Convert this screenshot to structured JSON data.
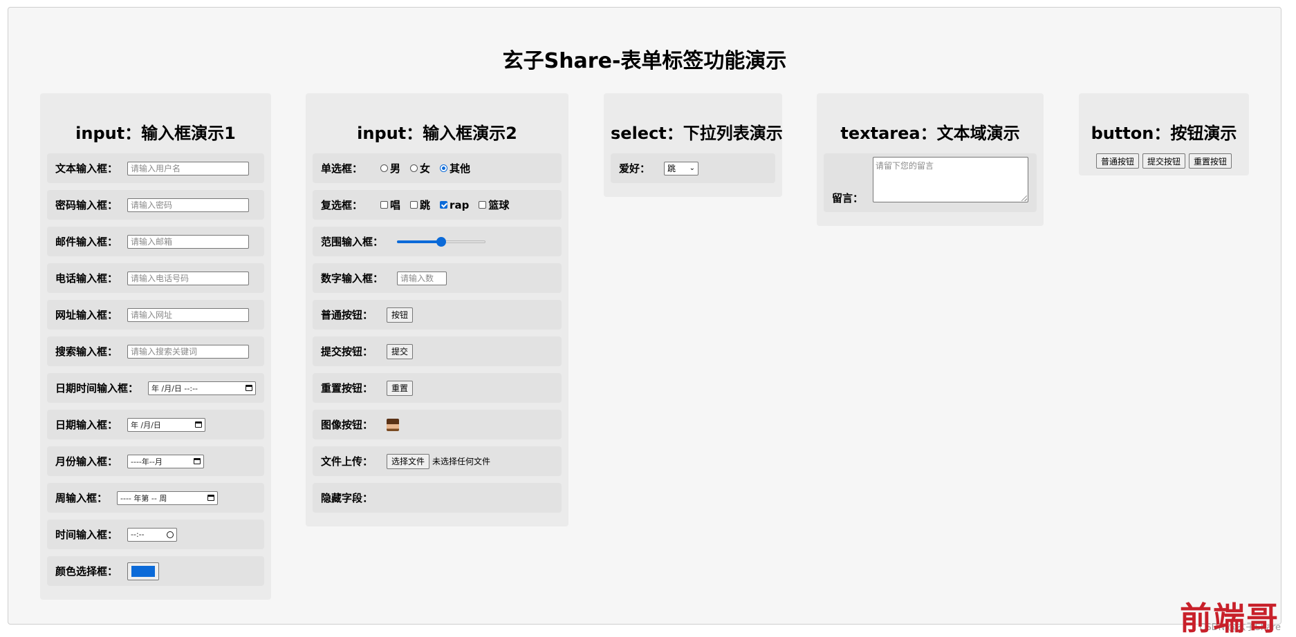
{
  "page_title": "玄子Share-表单标签功能演示",
  "col1": {
    "title": "input：输入框演示1",
    "text_label": "文本输入框：",
    "text_placeholder": "请输入用户名",
    "password_label": "密码输入框：",
    "password_placeholder": "请输入密码",
    "email_label": "邮件输入框：",
    "email_placeholder": "请输入邮箱",
    "tel_label": "电话输入框：",
    "tel_placeholder": "请输入电话号码",
    "url_label": "网址输入框：",
    "url_placeholder": "请输入网址",
    "search_label": "搜索输入框：",
    "search_placeholder": "请输入搜索关键词",
    "datetime_label": "日期时间输入框：",
    "datetime_value": "年 /月/日 --:--",
    "date_label": "日期输入框：",
    "date_value": "年 /月/日",
    "month_label": "月份输入框：",
    "month_value": "----年--月",
    "week_label": "周输入框：",
    "week_value": "---- 年第 -- 周",
    "time_label": "时间输入框：",
    "time_value": "--:--",
    "color_label": "颜色选择框：",
    "color_value": "#0b6ad8"
  },
  "col2": {
    "title": "input：输入框演示2",
    "radio_label": "单选框：",
    "radio_options": [
      "男",
      "女",
      "其他"
    ],
    "radio_selected": "其他",
    "checkbox_label": "复选框：",
    "checkbox_options": [
      "唱",
      "跳",
      "rap",
      "篮球"
    ],
    "checkbox_checked": [
      "rap"
    ],
    "range_label": "范围输入框：",
    "range_fraction": 0.5,
    "number_label": "数字输入框：",
    "number_placeholder": "请输入数",
    "normal_btn_label": "普通按钮：",
    "normal_btn_text": "按钮",
    "submit_btn_label": "提交按钮：",
    "submit_btn_text": "提交",
    "reset_btn_label": "重置按钮：",
    "reset_btn_text": "重置",
    "image_btn_label": "图像按钮：",
    "file_label": "文件上传：",
    "file_btn_text": "选择文件",
    "file_status": "未选择任何文件",
    "hidden_label": "隐藏字段："
  },
  "col3": {
    "title": "select：下拉列表演示",
    "hobby_label": "爱好：",
    "hobby_value": "跳"
  },
  "col4": {
    "title": "textarea：文本域演示",
    "message_label": "留言：",
    "message_placeholder": "请留下您的留言"
  },
  "col5": {
    "title": "button：按钮演示",
    "buttons": [
      "普通按钮",
      "提交按钮",
      "重置按钮"
    ]
  },
  "watermark": "CSDN @玄子Share",
  "logo_text": "前端哥"
}
